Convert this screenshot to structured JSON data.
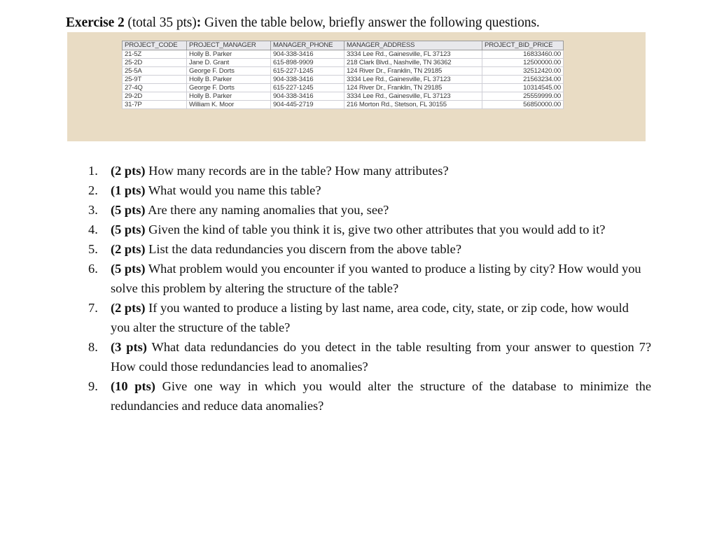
{
  "document": {
    "title_bold": "Exercise 2",
    "title_paren": " (total 35 pts)",
    "title_colon": ":",
    "title_rest": " Given the table below, briefly answer the following questions."
  },
  "table": {
    "columns": [
      "PROJECT_CODE",
      "PROJECT_MANAGER",
      "MANAGER_PHONE",
      "MANAGER_ADDRESS",
      "PROJECT_BID_PRICE"
    ],
    "rows": [
      [
        "21-5Z",
        "Holly B. Parker",
        "904-338-3416",
        "3334 Lee Rd., Gainesville, FL  37123",
        "16833460.00"
      ],
      [
        "25-2D",
        "Jane D. Grant",
        "615-898-9909",
        "218 Clark Blvd., Nashville, TN  36362",
        "12500000.00"
      ],
      [
        "25-5A",
        "George F. Dorts",
        "615-227-1245",
        "124 River Dr., Franklin, TN  29185",
        "32512420.00"
      ],
      [
        "25-9T",
        "Holly B. Parker",
        "904-338-3416",
        "3334 Lee Rd., Gainesville, FL  37123",
        "21563234.00"
      ],
      [
        "27-4Q",
        "George F. Dorts",
        "615-227-1245",
        "124 River Dr., Franklin, TN  29185",
        "10314545.00"
      ],
      [
        "29-2D",
        "Holly B. Parker",
        "904-338-3416",
        "3334 Lee Rd., Gainesville, FL  37123",
        "25559999.00"
      ],
      [
        "31-7P",
        "William K. Moor",
        "904-445-2719",
        "216 Morton Rd., Stetson, FL  30155",
        "56850000.00"
      ]
    ]
  },
  "questions": [
    {
      "number": "1.",
      "points": "(2 pts)",
      "text": " How many records are in the table? How many attributes?"
    },
    {
      "number": "2.",
      "points": "(1 pts)",
      "text": " What would you name this table?"
    },
    {
      "number": "3.",
      "points": "(5 pts)",
      "text": " Are there any naming anomalies that you, see?"
    },
    {
      "number": "4.",
      "points": "(5 pts)",
      "text": " Given the kind of table you think it is, give two other attributes that you would add to it?"
    },
    {
      "number": "5.",
      "points": "(2 pts)",
      "text": " List the data redundancies you discern from the above table?"
    },
    {
      "number": "6.",
      "points": "(5 pts)",
      "text": " What problem would you encounter if you wanted to produce a listing by city? How would you solve this problem by altering the structure of the table?"
    },
    {
      "number": "7.",
      "points": "(2 pts)",
      "text": " If you wanted to produce a listing by last name, area code, city, state, or zip code, how would you alter the structure of the table?"
    },
    {
      "number": "8.",
      "points": "(3 pts)",
      "text": " What data redundancies do you detect in the table resulting from your answer to question 7? How could those redundancies lead to anomalies?"
    },
    {
      "number": "9.",
      "points": "(10 pts)",
      "text": " Give one way in which you would alter the structure of the database to minimize the redundancies and reduce data anomalies?"
    }
  ]
}
